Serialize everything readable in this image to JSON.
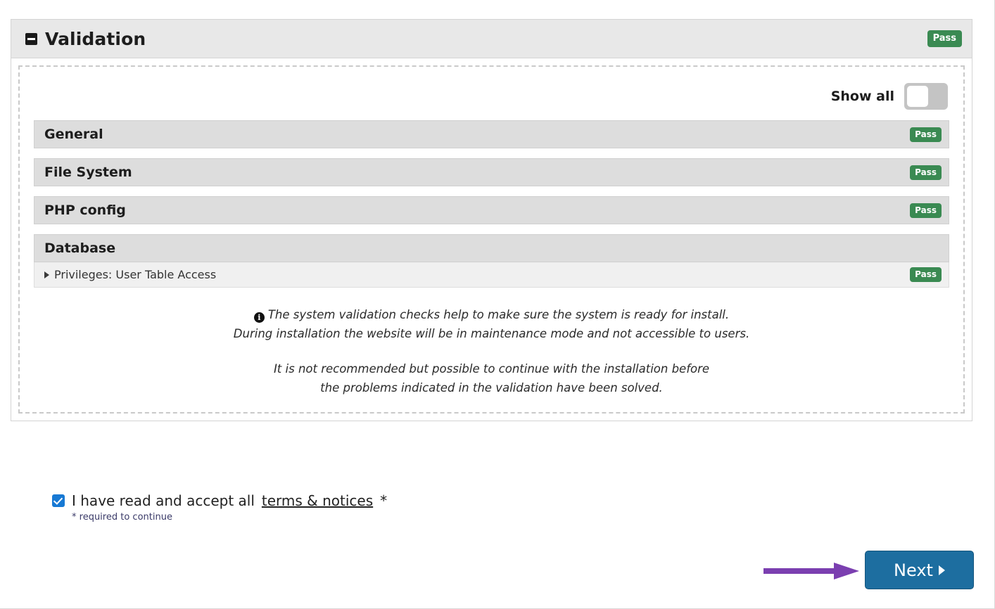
{
  "panel": {
    "title": "Validation",
    "collapse_icon": "minus-square-icon",
    "status": "Pass"
  },
  "show_all": {
    "label": "Show all",
    "state": "off"
  },
  "sections": [
    {
      "label": "General",
      "status": "Pass",
      "items": []
    },
    {
      "label": "File System",
      "status": "Pass",
      "items": []
    },
    {
      "label": "PHP config",
      "status": "Pass",
      "items": []
    },
    {
      "label": "Database",
      "status": "",
      "items": [
        {
          "label": "Privileges: User Table Access",
          "status": "Pass",
          "icon": "caret-right-icon"
        }
      ]
    }
  ],
  "notes": {
    "icon": "info-icon",
    "line1": "The system validation checks help to make sure the system is ready for install.",
    "line2": "During installation the website will be in maintenance mode and not accessible to users.",
    "line3": "It is not recommended but possible to continue with the installation before",
    "line4": "the problems indicated in the validation have been solved."
  },
  "terms": {
    "checked": true,
    "text_before": "I have read and accept all",
    "link_text": "terms & notices",
    "asterisk": "*",
    "required_note": "* required to continue"
  },
  "next_button": {
    "label": "Next",
    "caret": "caret-right-icon"
  },
  "annotation": {
    "arrow": "right-arrow-annotation",
    "color": "#7b3fb0"
  },
  "colors": {
    "pass_green": "#3a8a52",
    "button_blue": "#1d6ea0",
    "checkbox_blue": "#1779d4",
    "arrow_purple": "#7b3fb0"
  }
}
